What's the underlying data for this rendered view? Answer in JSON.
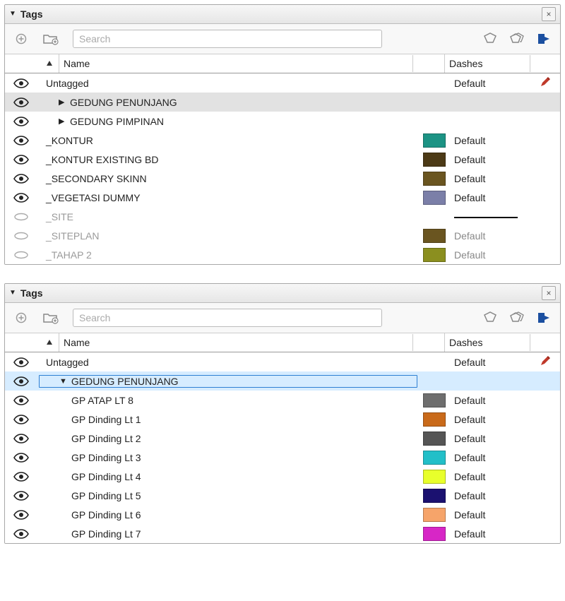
{
  "panel1": {
    "title": "Tags",
    "search_placeholder": "Search",
    "headers": {
      "name": "Name",
      "dashes": "Dashes"
    },
    "rows": [
      {
        "vis": "eye",
        "name": "Untagged",
        "indent": 0,
        "expander": "",
        "swatch": null,
        "dash": "Default",
        "edit": true
      },
      {
        "vis": "eye",
        "name": "GEDUNG PENUNJANG",
        "indent": 1,
        "expander": "right",
        "swatch": null,
        "dash": "",
        "sel": "gray"
      },
      {
        "vis": "eye",
        "name": "GEDUNG PIMPINAN",
        "indent": 1,
        "expander": "right",
        "swatch": null,
        "dash": ""
      },
      {
        "vis": "eye",
        "name": "_KONTUR",
        "indent": 0,
        "expander": "",
        "swatch": "#1c9384",
        "dash": "Default"
      },
      {
        "vis": "eye",
        "name": "_KONTUR EXISTING BD",
        "indent": 0,
        "expander": "",
        "swatch": "#4c3a16",
        "dash": "Default"
      },
      {
        "vis": "eye",
        "name": "_SECONDARY SKINN",
        "indent": 0,
        "expander": "",
        "swatch": "#6a5520",
        "dash": "Default"
      },
      {
        "vis": "eye",
        "name": "_VEGETASI DUMMY",
        "indent": 0,
        "expander": "",
        "swatch": "#7b7fa8",
        "dash": "Default"
      },
      {
        "vis": "off",
        "name": "_SITE",
        "indent": 0,
        "expander": "",
        "swatch": null,
        "dash": "line"
      },
      {
        "vis": "off",
        "name": "_SITEPLAN",
        "indent": 0,
        "expander": "",
        "swatch": "#6a5520",
        "dash": "Default",
        "hidden": true
      },
      {
        "vis": "off",
        "name": "_TAHAP 2",
        "indent": 0,
        "expander": "",
        "swatch": "#8b8f1f",
        "dash": "Default",
        "hidden": true
      }
    ]
  },
  "panel2": {
    "title": "Tags",
    "search_placeholder": "Search",
    "headers": {
      "name": "Name",
      "dashes": "Dashes"
    },
    "rows": [
      {
        "vis": "eye",
        "name": "Untagged",
        "indent": 0,
        "expander": "",
        "swatch": null,
        "dash": "Default",
        "edit": true
      },
      {
        "vis": "eye",
        "name": "GEDUNG PENUNJANG",
        "indent": 1,
        "expander": "down",
        "swatch": null,
        "dash": "",
        "sel": "blue"
      },
      {
        "vis": "eye",
        "name": "GP ATAP LT 8",
        "indent": 2,
        "expander": "",
        "swatch": "#6e6e6e",
        "dash": "Default"
      },
      {
        "vis": "eye",
        "name": "GP Dinding Lt 1",
        "indent": 2,
        "expander": "",
        "swatch": "#c96a1a",
        "dash": "Default"
      },
      {
        "vis": "eye",
        "name": "GP Dinding Lt 2",
        "indent": 2,
        "expander": "",
        "swatch": "#555555",
        "dash": "Default"
      },
      {
        "vis": "eye",
        "name": "GP Dinding Lt 3",
        "indent": 2,
        "expander": "",
        "swatch": "#22bfc8",
        "dash": "Default"
      },
      {
        "vis": "eye",
        "name": "GP Dinding Lt 4",
        "indent": 2,
        "expander": "",
        "swatch": "#e8ff2b",
        "dash": "Default"
      },
      {
        "vis": "eye",
        "name": "GP Dinding Lt 5",
        "indent": 2,
        "expander": "",
        "swatch": "#1b1170",
        "dash": "Default"
      },
      {
        "vis": "eye",
        "name": "GP Dinding Lt 6",
        "indent": 2,
        "expander": "",
        "swatch": "#f6a46a",
        "dash": "Default"
      },
      {
        "vis": "eye",
        "name": "GP Dinding Lt 7",
        "indent": 2,
        "expander": "",
        "swatch": "#d726c6",
        "dash": "Default"
      }
    ]
  }
}
